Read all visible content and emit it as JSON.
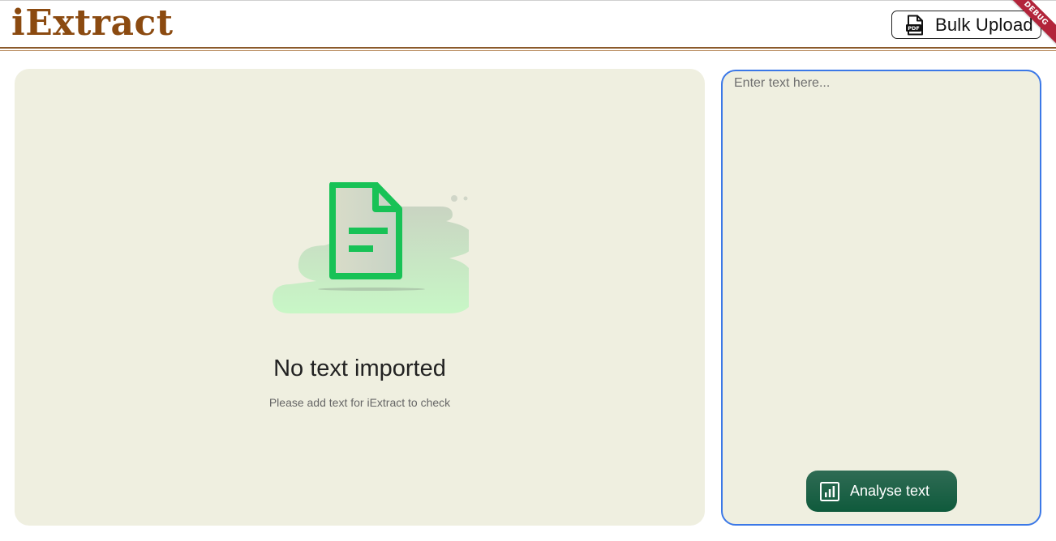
{
  "app": {
    "logo_text": "iExtract",
    "debug_badge": "DEBUG"
  },
  "header": {
    "bulk_upload_label": "Bulk Upload",
    "bulk_upload_icon": "pdf-file-icon"
  },
  "empty_state": {
    "title": "No text imported",
    "subtitle": "Please add text for iExtract to check",
    "illustration": "document-icon"
  },
  "text_panel": {
    "placeholder": "Enter text here...",
    "value": "",
    "analyse_label": "Analyse text",
    "analyse_icon": "bar-chart-icon"
  },
  "colors": {
    "logo": "#8b4a10",
    "panel_bg": "#efefe0",
    "input_border": "#3b78e7",
    "button_bg": "#145d40",
    "doc_green": "#18c256",
    "debug_ribbon": "#b2243a"
  }
}
